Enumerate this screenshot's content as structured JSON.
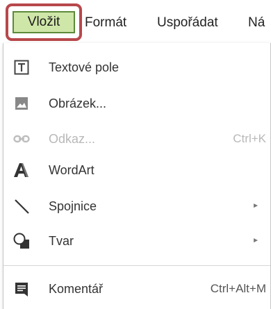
{
  "menubar": {
    "active": "Vložit",
    "items": [
      "Formát",
      "Uspořádat",
      "Ná"
    ]
  },
  "menu": {
    "items": [
      {
        "label": "Textové pole",
        "icon": "text-box-icon"
      },
      {
        "label": "Obrázek...",
        "icon": "image-icon"
      },
      {
        "label": "Odkaz...",
        "shortcut": "Ctrl+K",
        "icon": "link-icon",
        "disabled": true
      },
      {
        "label": "WordArt",
        "icon": "wordart-icon"
      },
      {
        "label": "Spojnice",
        "icon": "line-icon",
        "submenu": true
      },
      {
        "label": "Tvar",
        "icon": "shape-icon",
        "submenu": true
      },
      {
        "label": "Komentář",
        "shortcut": "Ctrl+Alt+M",
        "icon": "comment-icon"
      }
    ],
    "submenu_arrow": "►"
  },
  "colors": {
    "highlight_frame": "#b8484c",
    "active_background": "#cfe6a9",
    "active_border": "#5d8a3a",
    "disabled_text": "#b8b8b8"
  }
}
